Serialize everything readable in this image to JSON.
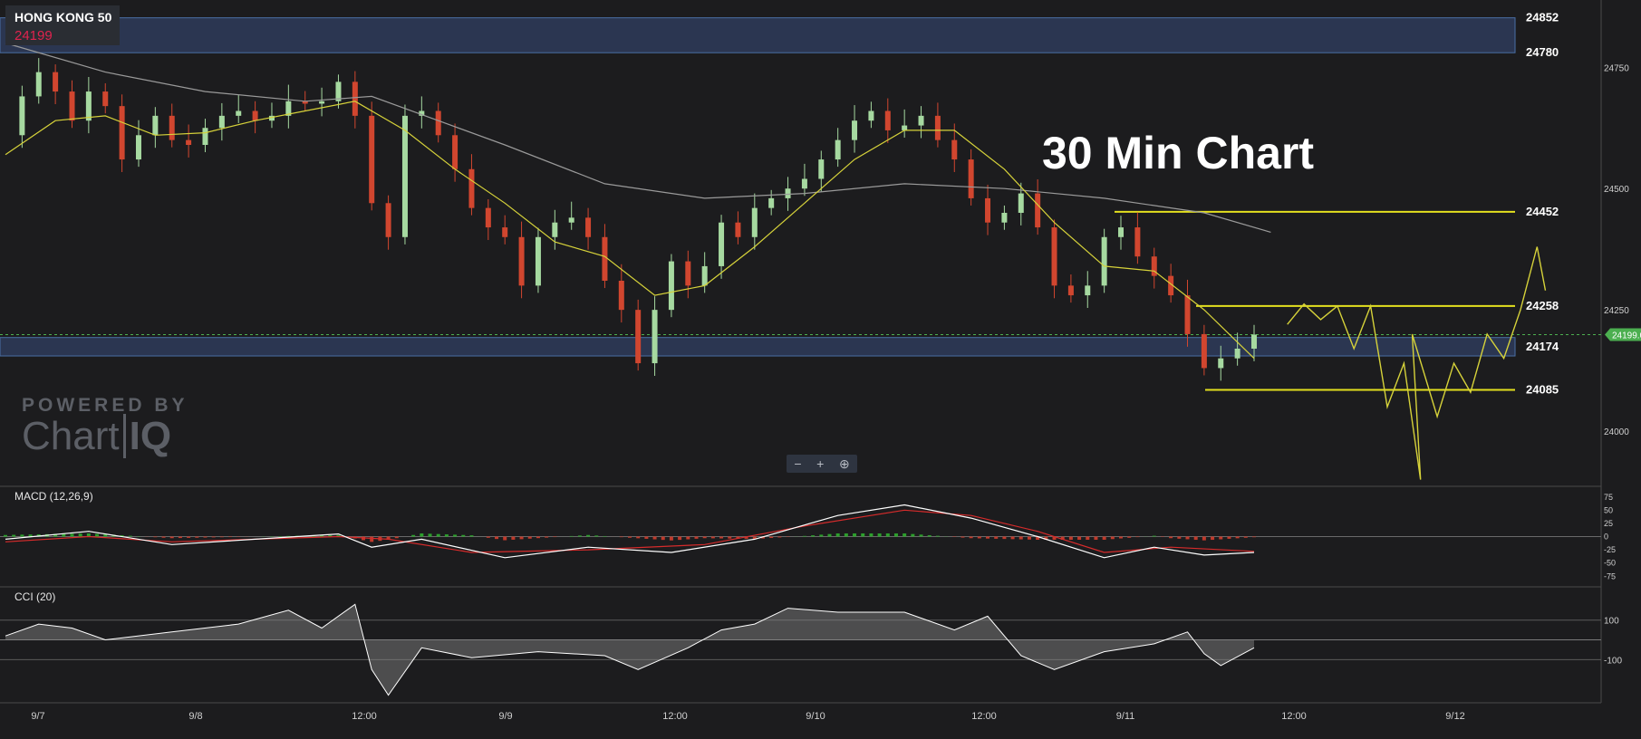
{
  "ticker": {
    "name": "HONG KONG 50",
    "price": "24199"
  },
  "chart_title": "30 Min Chart",
  "branding": {
    "powered_by": "POWERED BY",
    "chart": "Chart",
    "iq": "IQ"
  },
  "zoom_controls": {
    "zoom_out": "−",
    "zoom_in": "+",
    "zoom_reset": "⊕"
  },
  "icons": [
    "zoom-out-icon",
    "zoom-in-icon",
    "magnifier-icon"
  ],
  "colors": {
    "background": "#1c1c1e",
    "up": "#a6d9a0",
    "down": "#d1462f",
    "ma_fast": "#d6d23a",
    "ma_slow": "#9a9a9a",
    "level": "#e3e01f",
    "zone": "#2e3a57",
    "macd_line": "#ffffff",
    "signal_line": "#d62b2b",
    "hist_pos": "#2ca02c",
    "hist_neg": "#c0392b",
    "price_tag": "#4caf50"
  },
  "chart_data": [
    {
      "type": "line",
      "name": "price",
      "title": "HONG KONG 50",
      "ylim": [
        23890,
        24870
      ],
      "y_ticks": [
        "24750",
        "24500",
        "24250",
        "24000"
      ],
      "x_ticks": [
        "9/7",
        "9/8",
        "12:00",
        "9/9",
        "12:00",
        "9/10",
        "12:00",
        "9/11",
        "12:00",
        "9/12"
      ],
      "price_tag": "24199.00",
      "price_series": [
        [
          0,
          24610
        ],
        [
          1,
          24690
        ],
        [
          2,
          24740
        ],
        [
          3,
          24700
        ],
        [
          4,
          24640
        ],
        [
          5,
          24700
        ],
        [
          6,
          24670
        ],
        [
          7,
          24560
        ],
        [
          8,
          24610
        ],
        [
          9,
          24650
        ],
        [
          10,
          24600
        ],
        [
          11,
          24590
        ],
        [
          12,
          24625
        ],
        [
          13,
          24650
        ],
        [
          14,
          24660
        ],
        [
          15,
          24640
        ],
        [
          16,
          24650
        ],
        [
          17,
          24680
        ],
        [
          18,
          24675
        ],
        [
          19,
          24680
        ],
        [
          20,
          24720
        ],
        [
          21,
          24650
        ],
        [
          22,
          24470
        ],
        [
          23,
          24400
        ],
        [
          24,
          24650
        ],
        [
          25,
          24660
        ],
        [
          26,
          24610
        ],
        [
          27,
          24540
        ],
        [
          28,
          24460
        ],
        [
          29,
          24420
        ],
        [
          30,
          24400
        ],
        [
          31,
          24300
        ],
        [
          32,
          24400
        ],
        [
          33,
          24430
        ],
        [
          34,
          24440
        ],
        [
          35,
          24400
        ],
        [
          36,
          24310
        ],
        [
          37,
          24250
        ],
        [
          38,
          24140
        ],
        [
          39,
          24250
        ],
        [
          40,
          24350
        ],
        [
          41,
          24300
        ],
        [
          42,
          24340
        ],
        [
          43,
          24430
        ],
        [
          44,
          24400
        ],
        [
          45,
          24460
        ],
        [
          46,
          24480
        ],
        [
          47,
          24500
        ],
        [
          48,
          24520
        ],
        [
          49,
          24560
        ],
        [
          50,
          24600
        ],
        [
          51,
          24640
        ],
        [
          52,
          24660
        ],
        [
          53,
          24620
        ],
        [
          54,
          24630
        ],
        [
          55,
          24650
        ],
        [
          56,
          24600
        ],
        [
          57,
          24560
        ],
        [
          58,
          24480
        ],
        [
          59,
          24430
        ],
        [
          60,
          24450
        ],
        [
          61,
          24490
        ],
        [
          62,
          24420
        ],
        [
          63,
          24300
        ],
        [
          64,
          24280
        ],
        [
          65,
          24300
        ],
        [
          66,
          24400
        ],
        [
          67,
          24420
        ],
        [
          68,
          24360
        ],
        [
          69,
          24320
        ],
        [
          70,
          24280
        ],
        [
          71,
          24200
        ],
        [
          72,
          24130
        ],
        [
          73,
          24150
        ],
        [
          74,
          24170
        ],
        [
          75,
          24199
        ]
      ],
      "ma_fast": [
        [
          0,
          24570
        ],
        [
          3,
          24640
        ],
        [
          6,
          24650
        ],
        [
          9,
          24610
        ],
        [
          12,
          24615
        ],
        [
          15,
          24640
        ],
        [
          18,
          24660
        ],
        [
          21,
          24680
        ],
        [
          24,
          24620
        ],
        [
          27,
          24540
        ],
        [
          30,
          24470
        ],
        [
          33,
          24390
        ],
        [
          36,
          24360
        ],
        [
          39,
          24280
        ],
        [
          42,
          24300
        ],
        [
          45,
          24380
        ],
        [
          48,
          24470
        ],
        [
          51,
          24560
        ],
        [
          54,
          24620
        ],
        [
          57,
          24620
        ],
        [
          60,
          24540
        ],
        [
          63,
          24430
        ],
        [
          66,
          24340
        ],
        [
          69,
          24330
        ],
        [
          72,
          24250
        ],
        [
          75,
          24150
        ]
      ],
      "ma_slow": [
        [
          0,
          24800
        ],
        [
          6,
          24740
        ],
        [
          12,
          24700
        ],
        [
          18,
          24680
        ],
        [
          22,
          24690
        ],
        [
          26,
          24640
        ],
        [
          30,
          24590
        ],
        [
          36,
          24510
        ],
        [
          42,
          24480
        ],
        [
          48,
          24490
        ],
        [
          54,
          24510
        ],
        [
          60,
          24500
        ],
        [
          66,
          24480
        ],
        [
          72,
          24450
        ],
        [
          76,
          24410
        ]
      ],
      "levels": [
        {
          "label": "24852",
          "value": 24852
        },
        {
          "label": "24780",
          "value": 24780
        },
        {
          "label": "24452",
          "value": 24452
        },
        {
          "label": "24258",
          "value": 24258
        },
        {
          "label": "24174",
          "value": 24174
        },
        {
          "label": "24085",
          "value": 24085
        }
      ],
      "zones": [
        [
          24780,
          24852
        ],
        [
          24155,
          24193
        ]
      ],
      "projection": [
        [
          77,
          24220
        ],
        [
          78,
          24262
        ],
        [
          79,
          24230
        ],
        [
          80,
          24258
        ],
        [
          81,
          24170
        ],
        [
          82,
          24258
        ],
        [
          83,
          24050
        ],
        [
          84,
          24140
        ],
        [
          85,
          23900
        ],
        [
          84.5,
          24200
        ],
        [
          86,
          24030
        ],
        [
          87,
          24140
        ],
        [
          88,
          24080
        ],
        [
          89,
          24200
        ],
        [
          90,
          24150
        ],
        [
          91,
          24250
        ],
        [
          92,
          24380
        ],
        [
          92.5,
          24290
        ]
      ]
    },
    {
      "type": "line",
      "name": "MACD",
      "title": "MACD (12,26,9)",
      "ylim": [
        -90,
        90
      ],
      "y_ticks": [
        "75",
        "50",
        "25",
        "0",
        "-25",
        "-50",
        "-75"
      ],
      "macd_line": [
        [
          0,
          -5
        ],
        [
          5,
          10
        ],
        [
          10,
          -15
        ],
        [
          15,
          -5
        ],
        [
          20,
          5
        ],
        [
          22,
          -20
        ],
        [
          25,
          -5
        ],
        [
          30,
          -40
        ],
        [
          35,
          -20
        ],
        [
          40,
          -30
        ],
        [
          45,
          -5
        ],
        [
          50,
          40
        ],
        [
          54,
          60
        ],
        [
          58,
          35
        ],
        [
          62,
          0
        ],
        [
          66,
          -40
        ],
        [
          69,
          -20
        ],
        [
          72,
          -35
        ],
        [
          75,
          -30
        ]
      ],
      "signal_line": [
        [
          0,
          -10
        ],
        [
          5,
          0
        ],
        [
          10,
          -10
        ],
        [
          15,
          -5
        ],
        [
          20,
          0
        ],
        [
          23,
          -5
        ],
        [
          28,
          -30
        ],
        [
          35,
          -25
        ],
        [
          42,
          -15
        ],
        [
          48,
          20
        ],
        [
          54,
          50
        ],
        [
          58,
          40
        ],
        [
          62,
          10
        ],
        [
          66,
          -30
        ],
        [
          70,
          -20
        ],
        [
          75,
          -28
        ]
      ]
    },
    {
      "type": "area",
      "name": "CCI",
      "title": "CCI (20)",
      "ylim": [
        -300,
        250
      ],
      "y_ticks": [
        "100",
        "-100"
      ],
      "cci": [
        [
          0,
          20
        ],
        [
          2,
          80
        ],
        [
          4,
          60
        ],
        [
          6,
          0
        ],
        [
          10,
          40
        ],
        [
          14,
          80
        ],
        [
          17,
          150
        ],
        [
          19,
          60
        ],
        [
          21,
          180
        ],
        [
          22,
          -150
        ],
        [
          23,
          -280
        ],
        [
          25,
          -40
        ],
        [
          28,
          -90
        ],
        [
          32,
          -60
        ],
        [
          36,
          -80
        ],
        [
          38,
          -150
        ],
        [
          41,
          -40
        ],
        [
          43,
          50
        ],
        [
          45,
          80
        ],
        [
          47,
          160
        ],
        [
          50,
          140
        ],
        [
          54,
          140
        ],
        [
          57,
          50
        ],
        [
          59,
          120
        ],
        [
          61,
          -80
        ],
        [
          63,
          -150
        ],
        [
          66,
          -60
        ],
        [
          69,
          -20
        ],
        [
          71,
          40
        ],
        [
          72,
          -70
        ],
        [
          73,
          -130
        ],
        [
          75,
          -40
        ]
      ]
    }
  ]
}
